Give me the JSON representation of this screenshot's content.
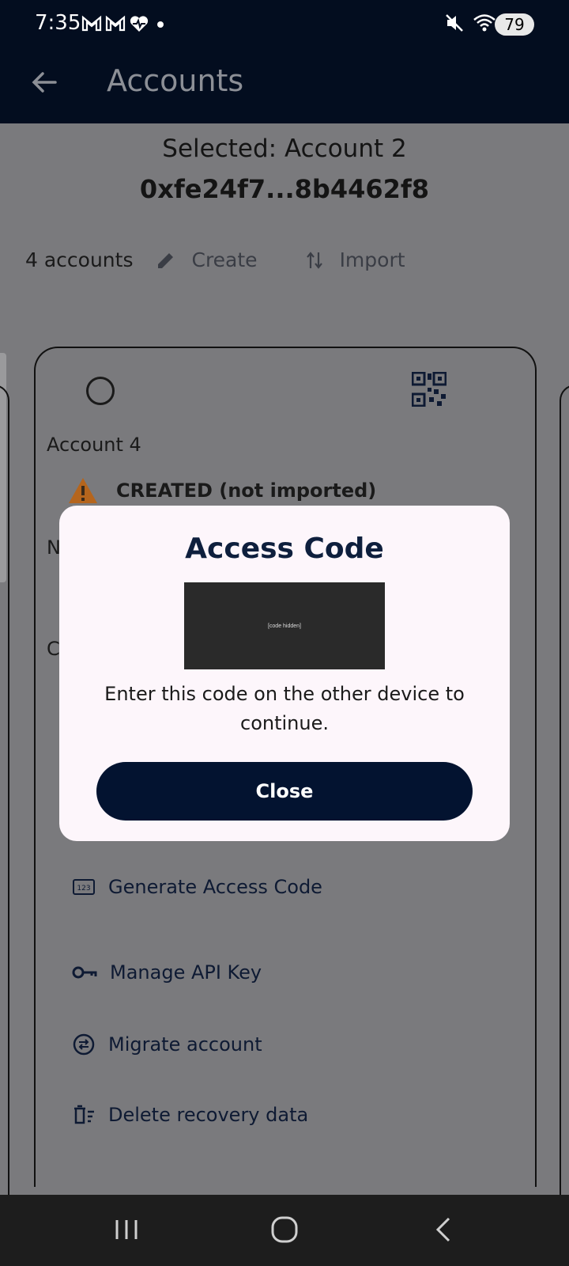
{
  "status_bar": {
    "time": "7:35",
    "battery": "79",
    "left_icons": [
      "gmail-icon",
      "gmail-icon",
      "health-icon",
      "dot-icon"
    ],
    "right_icons": [
      "mute-icon",
      "wifi-icon",
      "airplane-icon"
    ]
  },
  "app_bar": {
    "title": "Accounts"
  },
  "selection": {
    "label": "Selected: Account 2",
    "address": "0xfe24f7...8b4462f8"
  },
  "accounts_row": {
    "count": "4 accounts",
    "create_label": "Create",
    "import_label": "Import"
  },
  "card": {
    "account_name": "Account 4",
    "status": "CREATED (not imported)",
    "cut_n": "N",
    "cut_c": "C",
    "actions": [
      {
        "label": "Generate Access Code",
        "icon": "numeric-123-icon"
      },
      {
        "label": "Manage API Key",
        "icon": "key-icon"
      },
      {
        "label": "Migrate account",
        "icon": "swap-circle-icon"
      },
      {
        "label": "Delete recovery data",
        "icon": "delete-sweep-icon"
      }
    ]
  },
  "dialog": {
    "title": "Access Code",
    "code_placeholder": "[code hidden]",
    "message": "Enter this code on the other device to continue.",
    "close_label": "Close"
  },
  "colors": {
    "app_bar_bg": "#030d1f",
    "scrim_bg": "#7a7a7d",
    "dialog_bg": "#fdf6fb",
    "primary_button": "#031330",
    "warning": "#b5651d"
  }
}
